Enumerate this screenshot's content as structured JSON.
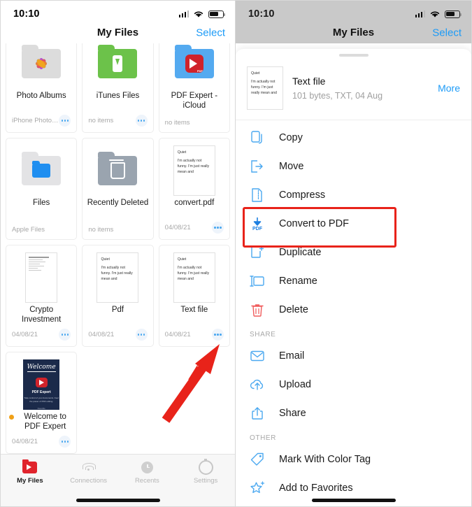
{
  "left": {
    "status": {
      "time": "10:10",
      "cellular_icon": "cellular-bars-icon",
      "wifi_icon": "wifi-icon",
      "battery_icon": "battery-icon"
    },
    "nav": {
      "title": "My Files",
      "select_label": "Select"
    },
    "files": [
      {
        "name": "Photo Albums",
        "sub": "iPhone Photo Lib...",
        "thumb": "folder-photos",
        "has_more": true,
        "badge": false
      },
      {
        "name": "iTunes Files",
        "sub": "no items",
        "thumb": "folder-itunes",
        "has_more": true,
        "badge": false
      },
      {
        "name": "PDF Expert - iCloud",
        "sub": "no items",
        "thumb": "folder-pdfexpert",
        "has_more": false,
        "badge": false
      },
      {
        "name": "Files",
        "sub": "Apple Files",
        "thumb": "folder-files",
        "has_more": false,
        "badge": false
      },
      {
        "name": "Recently Deleted",
        "sub": "no items",
        "thumb": "folder-trash",
        "has_more": false,
        "badge": false
      },
      {
        "name": "convert.pdf",
        "sub": "04/08/21",
        "thumb": "doc-text",
        "has_more": true,
        "badge": false
      },
      {
        "name": "Crypto Investment",
        "sub": "04/08/21",
        "thumb": "doc-lines",
        "has_more": true,
        "badge": false
      },
      {
        "name": "Pdf",
        "sub": "04/08/21",
        "thumb": "doc-text",
        "has_more": true,
        "badge": false
      },
      {
        "name": "Text file",
        "sub": "04/08/21",
        "thumb": "doc-text",
        "has_more": true,
        "badge": false
      },
      {
        "name": "Welcome to PDF Expert",
        "sub": "04/08/21",
        "thumb": "welcome-cover",
        "has_more": true,
        "badge": true
      }
    ],
    "doc_preview": {
      "heading": "Quiet",
      "body": "I'm actually not funny. I'm just really mean and"
    },
    "welcome_cover": {
      "title": "Welcome",
      "app": "PDF Expert",
      "tagline": "Take control of your documents. Feel the power of PDF editing.",
      "brand": "Readdle"
    },
    "fab": {
      "icon": "plus-icon"
    },
    "tabs": [
      {
        "label": "My Files",
        "icon": "pdf-expert-folder-icon",
        "active": true
      },
      {
        "label": "Connections",
        "icon": "wifi-icon",
        "active": false
      },
      {
        "label": "Recents",
        "icon": "clock-icon",
        "active": false
      },
      {
        "label": "Settings",
        "icon": "gear-icon",
        "active": false
      }
    ]
  },
  "right": {
    "status": {
      "time": "10:10",
      "cellular_icon": "cellular-bars-icon",
      "wifi_icon": "wifi-icon",
      "battery_icon": "battery-icon"
    },
    "nav": {
      "title": "My Files",
      "select_label": "Select"
    },
    "file": {
      "name": "Text file",
      "meta": "101 bytes, TXT, 04 Aug",
      "more_label": "More",
      "preview_heading": "Quiet",
      "preview_body": "I'm actually not funny. I'm just really mean and"
    },
    "menu": [
      {
        "label": "Copy",
        "icon": "copy-icon",
        "section": null,
        "highlighted": false
      },
      {
        "label": "Move",
        "icon": "move-arrow-icon",
        "section": null,
        "highlighted": false
      },
      {
        "label": "Compress",
        "icon": "compress-zip-icon",
        "section": null,
        "highlighted": false
      },
      {
        "label": "Convert to PDF",
        "icon": "convert-to-pdf-icon",
        "section": null,
        "highlighted": true
      },
      {
        "label": "Duplicate",
        "icon": "duplicate-icon",
        "section": null,
        "highlighted": false
      },
      {
        "label": "Rename",
        "icon": "rename-icon",
        "section": null,
        "highlighted": false
      },
      {
        "label": "Delete",
        "icon": "trash-icon",
        "section": null,
        "highlighted": false
      }
    ],
    "section_share": "SHARE",
    "menu_share": [
      {
        "label": "Email",
        "icon": "envelope-icon"
      },
      {
        "label": "Upload",
        "icon": "cloud-upload-icon"
      },
      {
        "label": "Share",
        "icon": "share-box-icon"
      }
    ],
    "section_other": "OTHER",
    "menu_other": [
      {
        "label": "Mark With Color Tag",
        "icon": "tag-icon"
      },
      {
        "label": "Add to Favorites",
        "icon": "star-plus-icon"
      }
    ],
    "pdf_icon_text": "PDF"
  },
  "annotation": {
    "highlight_color": "#e8231a",
    "arrow_color": "#e8231a",
    "arrow_label": "pointing-arrow"
  }
}
